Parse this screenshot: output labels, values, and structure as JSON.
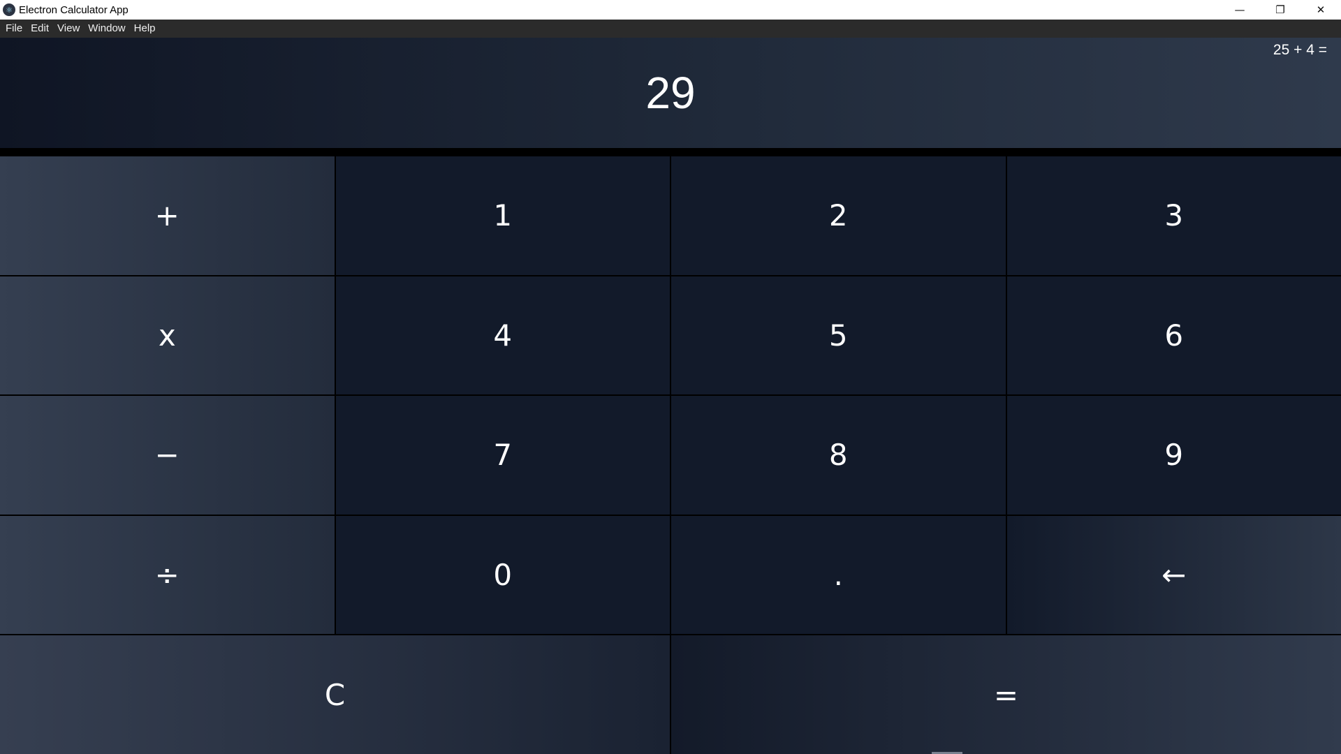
{
  "window": {
    "title": "Electron Calculator App",
    "controls": {
      "minimize": "—",
      "restore": "❐",
      "close": "✕"
    }
  },
  "menu": [
    "File",
    "Edit",
    "View",
    "Window",
    "Help"
  ],
  "display": {
    "expression": "25 + 4 =",
    "result": "29"
  },
  "keys": {
    "plus": "+",
    "one": "1",
    "two": "2",
    "three": "3",
    "multiply": "x",
    "four": "4",
    "five": "5",
    "six": "6",
    "minus": "−",
    "seven": "7",
    "eight": "8",
    "nine": "9",
    "divide": "÷",
    "zero": "0",
    "decimal": ".",
    "backspace": "←",
    "clear": "C",
    "equals": "="
  },
  "colors": {
    "display_bg_start": "#0f1524",
    "display_bg_end": "#2f3a4c",
    "key_bg": "#121a2a",
    "operator_bg": "#353f51",
    "menubar_bg": "#2b2b2b"
  }
}
